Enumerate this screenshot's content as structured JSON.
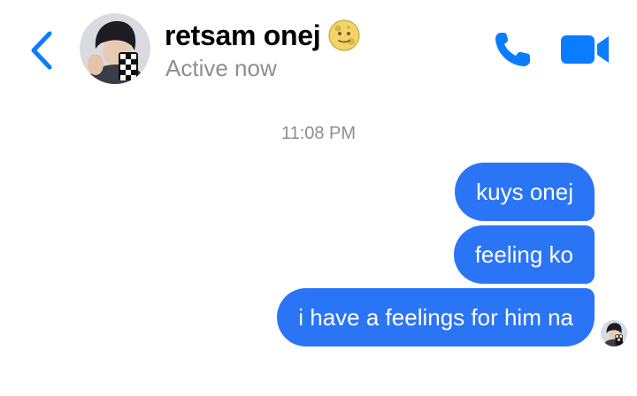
{
  "header": {
    "back_icon": "chevron-left-icon",
    "contact_name": "retsam onej",
    "name_emoji": "moon-face-emoji",
    "status": "Active now",
    "call_icon": "phone-icon",
    "video_icon": "video-camera-icon"
  },
  "conversation": {
    "timestamp": "11:08 PM",
    "messages": [
      {
        "text": "kuys onej",
        "sender": "me"
      },
      {
        "text": "feeling ko",
        "sender": "me"
      },
      {
        "text": "i have a feelings for him na",
        "sender": "me"
      }
    ],
    "read_receipt": "seen-avatar"
  },
  "colors": {
    "accent": "#0a7cff",
    "bubble": "#2a74f6",
    "muted_text": "#8e8e93"
  }
}
